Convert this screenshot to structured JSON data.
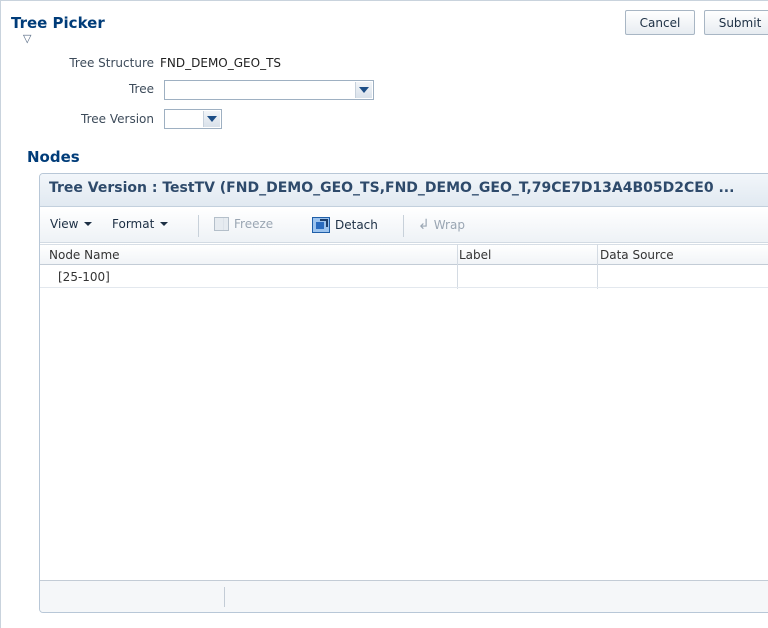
{
  "header": {
    "title": "Tree Picker",
    "cancel_label": "Cancel",
    "submit_label": "Submit"
  },
  "form": {
    "tree_structure_label": "Tree Structure",
    "tree_structure_value": "FND_DEMO_GEO_TS",
    "tree_label": "Tree",
    "tree_value": "",
    "tree_version_label": "Tree Version",
    "tree_version_value": ""
  },
  "nodes": {
    "heading": "Nodes",
    "panel_title": "Tree Version : TestTV (FND_DEMO_GEO_TS,FND_DEMO_GEO_T,79CE7D13A4B05D2CE0 ...",
    "toolbar": {
      "view_label": "View",
      "format_label": "Format",
      "freeze_label": "Freeze",
      "detach_label": "Detach",
      "wrap_label": "Wrap"
    },
    "columns": [
      "Node Name",
      "Label",
      "Data Source"
    ],
    "rows": [
      {
        "node_name": "[25-100]",
        "label": "",
        "data_source": ""
      }
    ]
  },
  "icons": {
    "disclosure": "disclosure-triangle-icon",
    "dropdown": "chevron-down-icon",
    "freeze": "freeze-columns-icon",
    "detach": "detach-icon",
    "wrap": "wrap-icon"
  },
  "colors": {
    "title": "#003c79",
    "panel_title": "#2e4a6b",
    "border": "#b8c7d7"
  }
}
